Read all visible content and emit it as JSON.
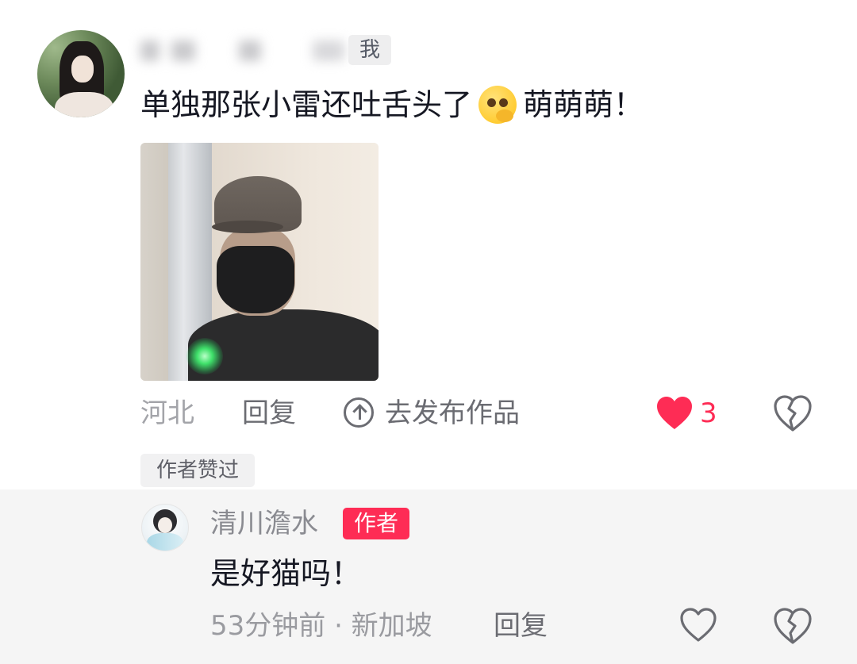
{
  "main_comment": {
    "username": "",
    "me_badge": "我",
    "text_before_emoji": "单独那张小雷还吐舌头了",
    "emoji": "shy-pleading-emoji",
    "text_after_emoji": "萌萌萌！",
    "location": "河北",
    "reply_label": "回复",
    "publish_label": "去发布作品",
    "like_count": "3",
    "liked": true,
    "author_liked_label": "作者赞过"
  },
  "reply_comment": {
    "username": "清川澹水",
    "author_badge": "作者",
    "text": "是好猫吗！",
    "time_location": "53分钟前 · 新加坡",
    "reply_label": "回复",
    "liked": false
  },
  "colors": {
    "accent": "#fe2c55",
    "secondary_text": "#8a8b91",
    "reply_background": "#f5f5f5"
  }
}
